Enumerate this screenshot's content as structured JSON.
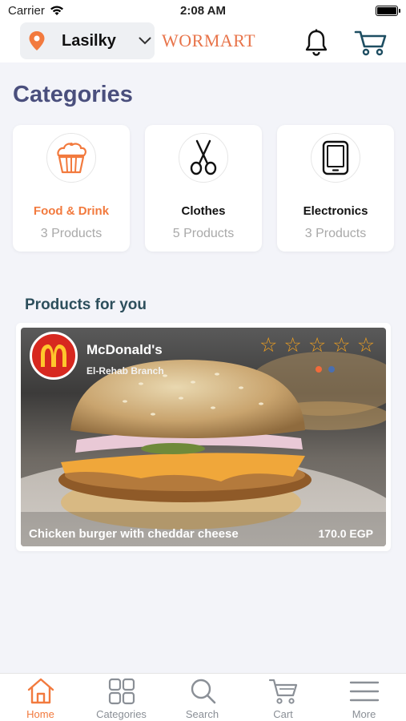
{
  "status_bar": {
    "carrier": "Carrier",
    "time": "2:08 AM"
  },
  "header": {
    "location": "Lasilky",
    "brand": "WORMART",
    "icons": [
      "location-pin-icon",
      "chevron-down-icon",
      "bell-icon",
      "cart-icon"
    ]
  },
  "categories": {
    "title": "Categories",
    "items": [
      {
        "name": "Food & Drink",
        "count": "3 Products",
        "icon": "cupcake-icon",
        "active": true
      },
      {
        "name": "Clothes",
        "count": "5 Products",
        "icon": "scissors-icon",
        "active": false
      },
      {
        "name": "Electronics",
        "count": "3 Products",
        "icon": "tablet-icon",
        "active": false
      }
    ]
  },
  "products": {
    "title": "Products for you",
    "items": [
      {
        "store": "McDonald's",
        "branch": "El-Rehab Branch",
        "name": "Chicken burger with cheddar cheese",
        "price": "170.0 EGP",
        "rating_stars": 5,
        "rating_filled": 0,
        "carousel_dots": [
          "#f26a3a",
          "#4a6fb0"
        ]
      }
    ]
  },
  "tabbar": {
    "tabs": [
      {
        "label": "Home",
        "icon": "home-icon",
        "active": true
      },
      {
        "label": "Categories",
        "icon": "grid-icon",
        "active": false
      },
      {
        "label": "Search",
        "icon": "search-icon",
        "active": false
      },
      {
        "label": "Cart",
        "icon": "cart-icon",
        "active": false
      },
      {
        "label": "More",
        "icon": "menu-icon",
        "active": false
      }
    ]
  },
  "colors": {
    "accent": "#f27a3e",
    "title": "#4a4f7d",
    "star": "#f0a020",
    "mcd_red": "#d7281f"
  }
}
